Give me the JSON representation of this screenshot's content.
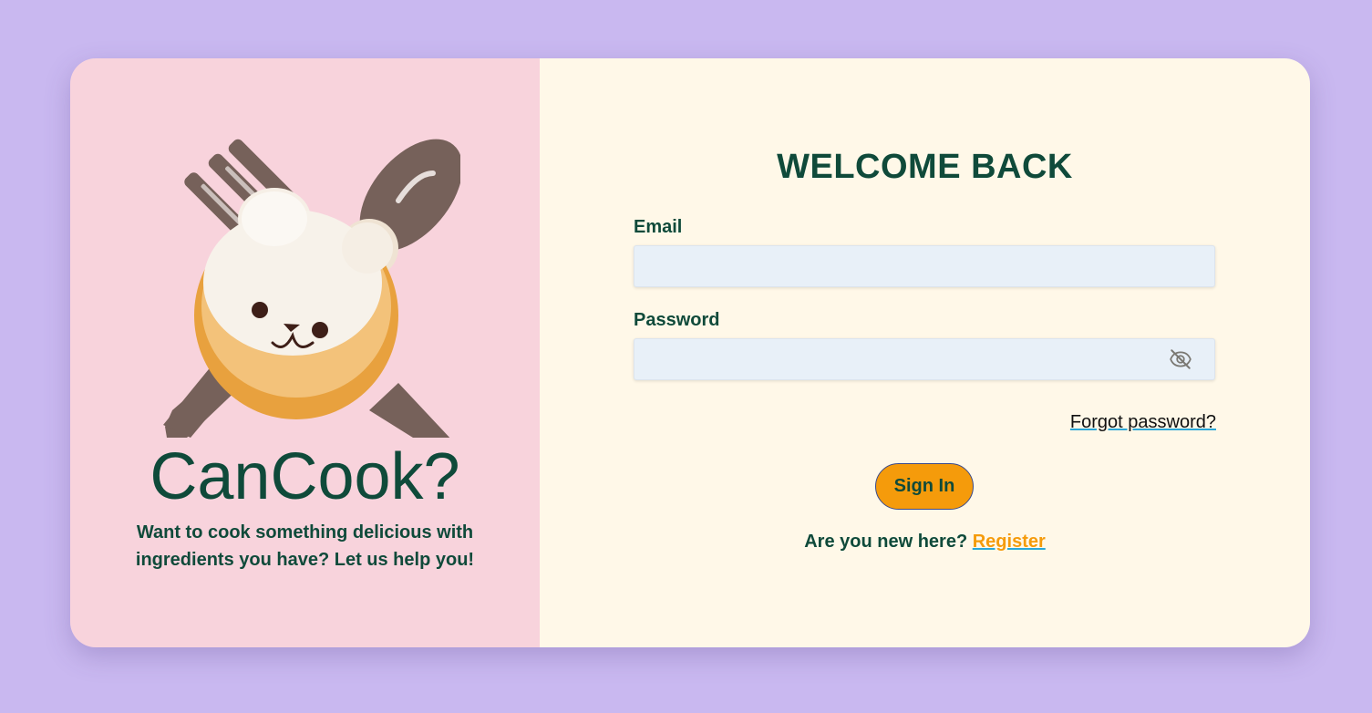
{
  "brand": {
    "name": "CanCook?",
    "tagline": "Want to cook something delicious with ingredients you have? Let us help you!"
  },
  "login": {
    "title": "WELCOME BACK",
    "email_label": "Email",
    "email_value": "",
    "password_label": "Password",
    "password_value": "",
    "forgot_label": "Forgot password?",
    "signin_label": "Sign In",
    "register_prompt": "Are you new here?",
    "register_label": "Register"
  },
  "colors": {
    "background": "#c9b8f0",
    "left_panel": "#f8d3dc",
    "right_panel": "#fff8e8",
    "text": "#0f4a3a",
    "accent": "#f59b0b",
    "input_bg": "#e8f0f8"
  },
  "icons": {
    "logo": "fork-spoon-bear-bun-icon",
    "password_toggle": "eye-off-icon"
  }
}
